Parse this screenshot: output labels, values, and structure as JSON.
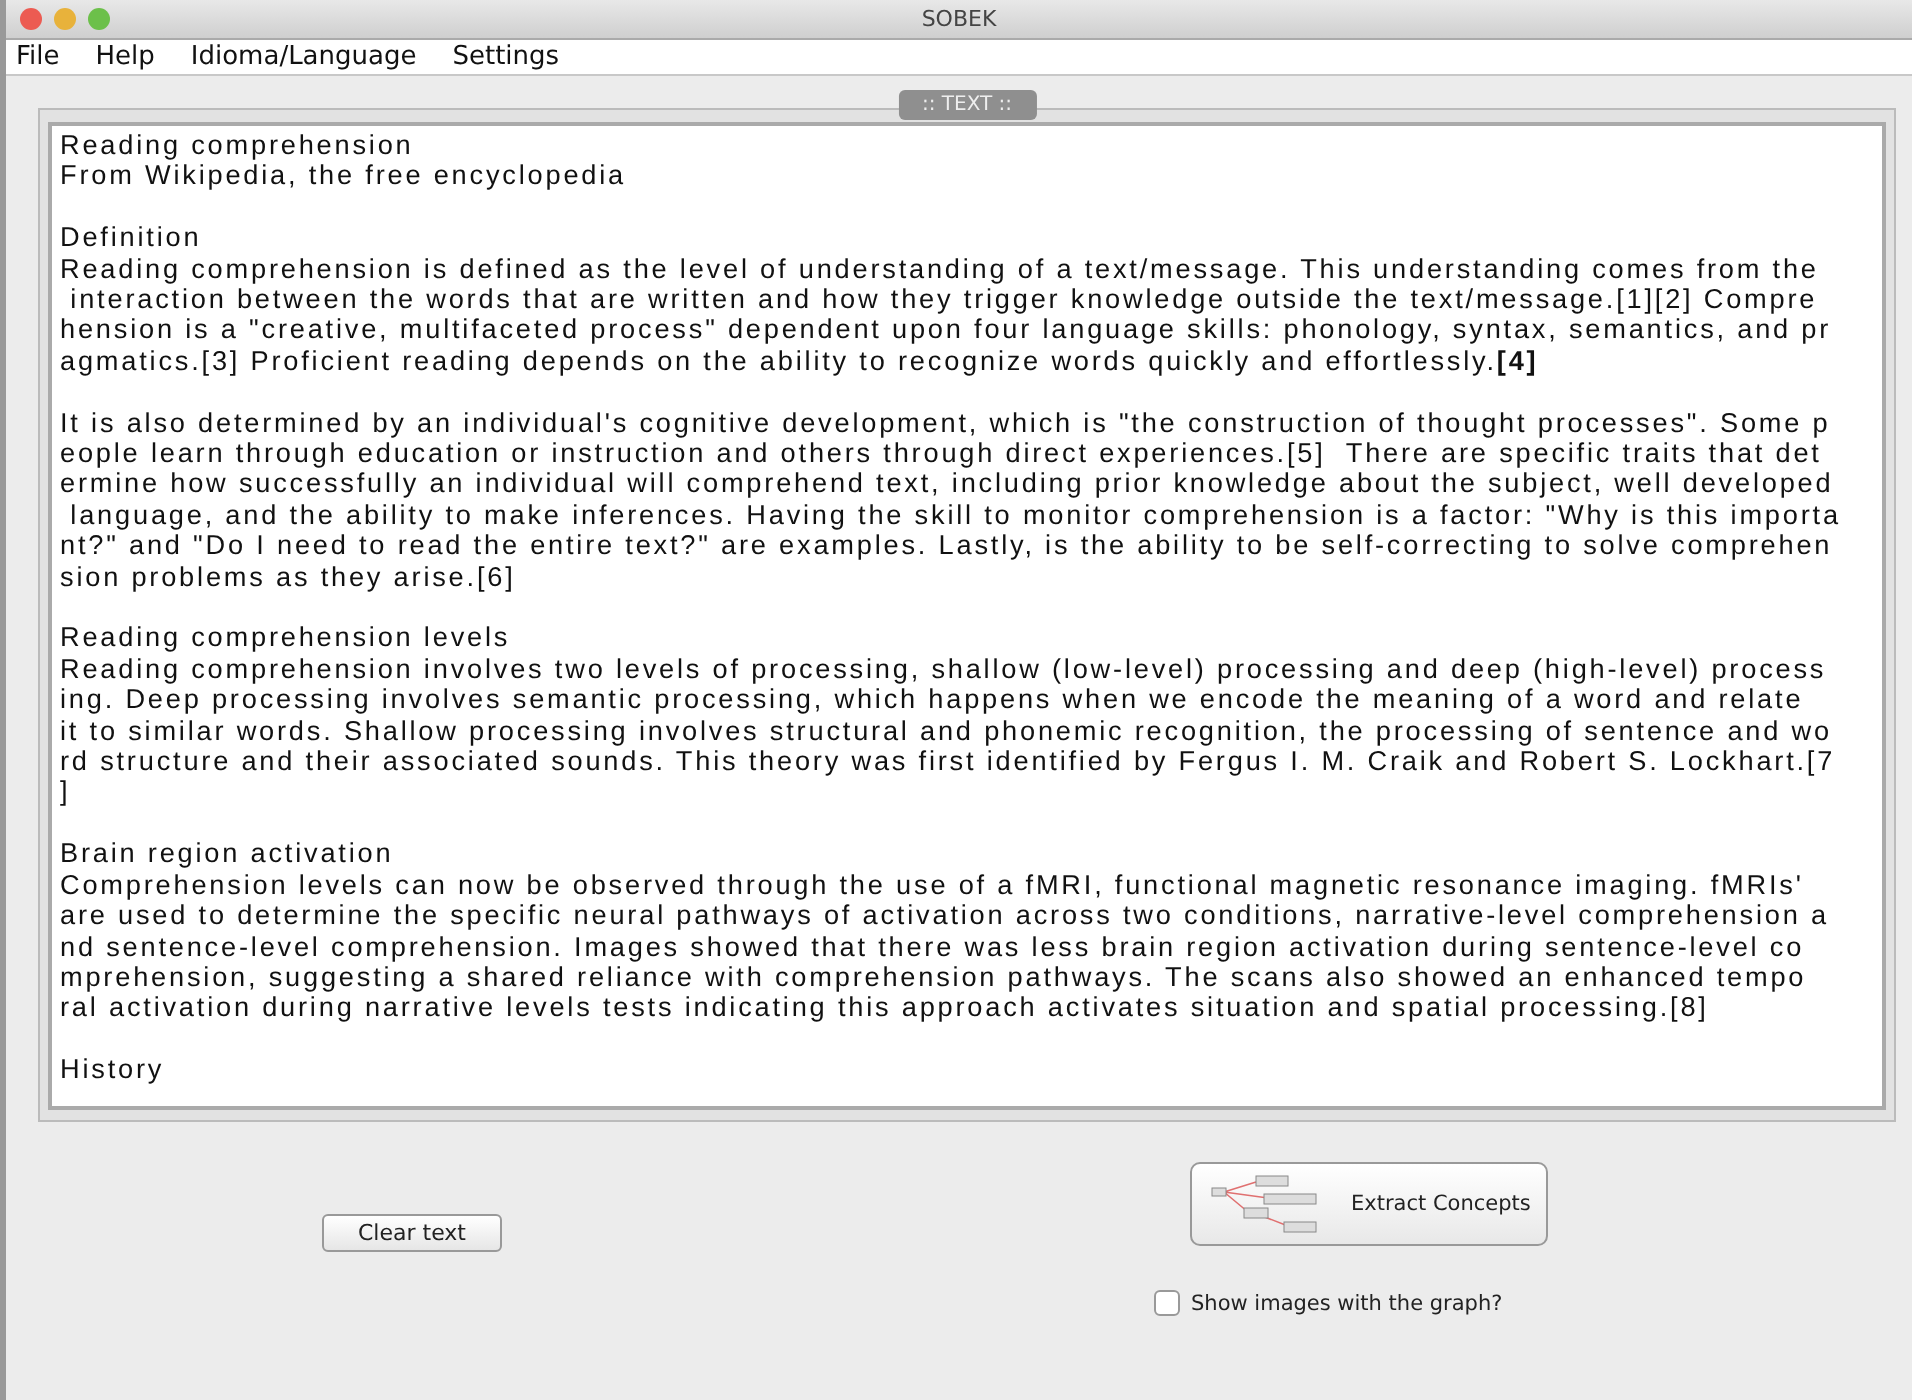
{
  "window": {
    "title": "SOBEK"
  },
  "menu": [
    "File",
    "Help",
    "Idioma/Language",
    "Settings"
  ],
  "panel": {
    "tab": ":: TEXT ::"
  },
  "text_paragraphs": [
    [
      "Reading comprehension",
      "From Wikipedia, the free encyclopedia"
    ],
    [
      "Definition",
      "Reading comprehension is defined as the level of understanding of a text/message. This understanding comes from the",
      " interaction between the words that are written and how they trigger knowledge outside the text/message.[1][2] Compre",
      "hension is a \"creative, multifaceted process\" dependent upon four language skills: phonology, syntax, semantics, and pr",
      "agmatics.[3] Proficient reading depends on the ability to recognize words quickly and effortlessly.**[4]**"
    ],
    [
      "It is also determined by an individual's cognitive development, which is \"the construction of thought processes\". Some p",
      "eople learn through education or instruction and others through direct experiences.[5]  There are specific traits that det",
      "ermine how successfully an individual will comprehend text, including prior knowledge about the subject, well developed",
      " language, and the ability to make inferences. Having the skill to monitor comprehension is a factor: \"Why is this importa",
      "nt?\" and \"Do I need to read the entire text?\" are examples. Lastly, is the ability to be self-correcting to solve comprehen",
      "sion problems as they arise.[6]"
    ],
    [
      "Reading comprehension levels",
      "Reading comprehension involves two levels of processing, shallow (low-level) processing and deep (high-level) process",
      "ing. Deep processing involves semantic processing, which happens when we encode the meaning of a word and relate",
      "it to similar words. Shallow processing involves structural and phonemic recognition, the processing of sentence and wo",
      "rd structure and their associated sounds. This theory was first identified by Fergus I. M. Craik and Robert S. Lockhart.[7",
      "]"
    ],
    [
      "Brain region activation",
      "Comprehension levels can now be observed through the use of a fMRI, functional magnetic resonance imaging. fMRIs'",
      "are used to determine the specific neural pathways of activation across two conditions, narrative-level comprehension a",
      "nd sentence-level comprehension. Images showed that there was less brain region activation during sentence-level co",
      "mprehension, suggesting a shared reliance with comprehension pathways. The scans also showed an enhanced tempo",
      "ral activation during narrative levels tests indicating this approach activates situation and spatial processing.[8]"
    ],
    [
      "History"
    ]
  ],
  "buttons": {
    "clear": "Clear text",
    "extract": "Extract Concepts"
  },
  "show_images": {
    "label": "Show images with the graph?",
    "checked": false
  }
}
